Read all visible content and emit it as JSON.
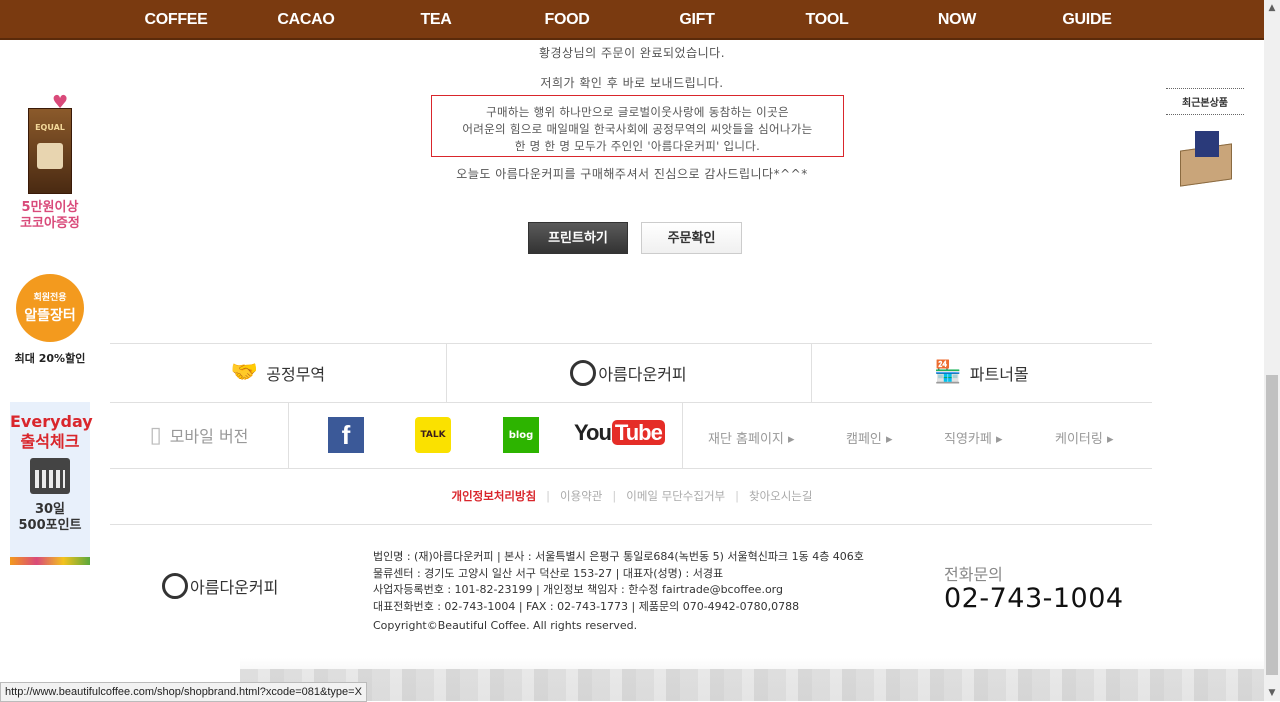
{
  "nav": [
    "COFFEE",
    "CACAO",
    "TEA",
    "FOOD",
    "GIFT",
    "TOOL",
    "NOW",
    "GUIDE"
  ],
  "order": {
    "line1": "황경상님의 주문이 완료되었습니다.",
    "line2": "저희가 확인 후 바로 보내드립니다.",
    "box": [
      "구매하는 행위 하나만으로 글로벌이웃사랑에 동참하는 이곳은",
      "어려운의 힘으로 매일매일 한국사회에 공정무역의 씨앗들을 심어나가는",
      "한 명 한 명 모두가 주인인 '아름다운커피' 입니다."
    ],
    "thanks": "오늘도 아름다운커피를 구매해주셔서 진심으로 감사드립니다*^^*",
    "print_btn": "프린트하기",
    "confirm_btn": "주문확인"
  },
  "left": {
    "pack_label": "EQUAL",
    "cocoa": [
      "5만원이상",
      "코코아증정"
    ],
    "market_small": "회원전용",
    "market_big": "알뜰장터",
    "discount": "최대 20%할인",
    "everyday": [
      "Everyday",
      "출석체크"
    ],
    "points": [
      "30일",
      "500포인트"
    ]
  },
  "right": {
    "recent": "최근본상품"
  },
  "footer": {
    "fair": "공정무역",
    "brand": "아름다운커피",
    "partner": "파트너몰",
    "mobile": "모바일 버전",
    "sns": {
      "fb": "f",
      "talk": "TALK",
      "blog": "blog",
      "yt_you": "You",
      "yt_tube": "Tube"
    },
    "links": [
      "재단 홈페이지 ▸",
      "캠페인 ▸",
      "직영카페 ▸",
      "케이터링 ▸"
    ],
    "policy": [
      "개인정보처리방침",
      "이용약관",
      "이메일 무단수집거부",
      "찾아오시는길"
    ],
    "logo": "아름다운커피",
    "info": [
      "법인명 : (재)아름다운커피   |   본사 : 서울특별시 은평구 통일로684(녹번동 5) 서울혁신파크 1동 4층 406호",
      "물류센터 : 경기도 고양시 일산 서구 덕산로 153-27   |   대표자(성명) : 서경표",
      "사업자등록번호 : 101-82-23199   |   개인정보 책임자 : 한수정 fairtrade@bcoffee.org",
      "대표전화번호 : 02-743-1004   |   FAX : 02-743-1773   |   제품문의 070-4942-0780,0788"
    ],
    "copyright": "Copyright©Beautiful Coffee. All rights reserved.",
    "phone_label": "전화문의",
    "phone": "02-743-1004"
  },
  "status_url": "http://www.beautifulcoffee.com/shop/shopbrand.html?xcode=081&type=X"
}
